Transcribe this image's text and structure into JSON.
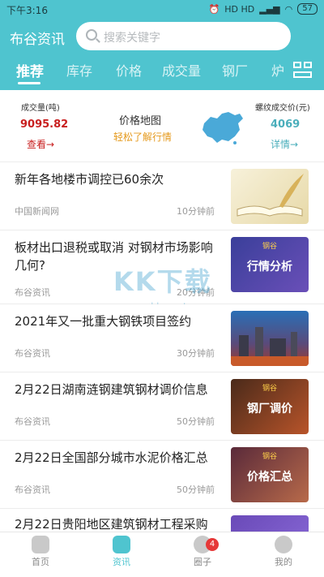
{
  "status_bar": {
    "time": "下午3:16",
    "indicators": "HD HD",
    "battery": "57"
  },
  "header": {
    "brand": "布谷资讯",
    "search_placeholder": "搜索关键字",
    "tabs": [
      {
        "label": "推荐",
        "active": true
      },
      {
        "label": "库存",
        "active": false
      },
      {
        "label": "价格",
        "active": false
      },
      {
        "label": "成交量",
        "active": false
      },
      {
        "label": "钢厂",
        "active": false
      },
      {
        "label": "炉",
        "active": false
      }
    ],
    "accent_color": "#4fc4cf"
  },
  "market_summary": {
    "volume_label": "成交量(吨)",
    "volume_value": "9095.82",
    "volume_link": "查看→",
    "map_title": "价格地图",
    "map_subtitle": "轻松了解行情",
    "price_label": "螺纹成交价(元)",
    "price_value": "4069",
    "price_link": "详情→"
  },
  "news": [
    {
      "title": "新年各地楼市调控已60余次",
      "source": "中国新闻网",
      "time": "10分钟前",
      "thumb": "book-quill",
      "thumb_text": ""
    },
    {
      "title": "板材出口退税或取消 对钢材市场影响几何?",
      "source": "布谷资讯",
      "time": "20分钟前",
      "thumb": "steel-analysis",
      "thumb_text": "行情分析",
      "thumb_small": "钢谷"
    },
    {
      "title": "2021年又一批重大钢铁项目签约",
      "source": "布谷资讯",
      "time": "30分钟前",
      "thumb": "steel-plant",
      "thumb_text": ""
    },
    {
      "title": "2月22日湖南涟钢建筑钢材调价信息",
      "source": "布谷资讯",
      "time": "50分钟前",
      "thumb": "mill-price",
      "thumb_text": "钢厂调价",
      "thumb_small": "钢谷"
    },
    {
      "title": "2月22日全国部分城市水泥价格汇总",
      "source": "布谷资讯",
      "time": "50分钟前",
      "thumb": "price-summary",
      "thumb_text": "价格汇总",
      "thumb_small": "钢谷"
    },
    {
      "title": "2月22日贵阳地区建筑钢材工程采购",
      "source": "",
      "time": "",
      "thumb": "crane",
      "thumb_text": "",
      "thumb_small": "钢谷"
    }
  ],
  "watermark": {
    "text": "KK下载",
    "url": "www.kkx.net"
  },
  "bottom_nav": [
    {
      "label": "首页",
      "icon": "home-icon",
      "active": false
    },
    {
      "label": "资讯",
      "icon": "news-icon",
      "active": true
    },
    {
      "label": "圈子",
      "icon": "circle-icon",
      "active": false,
      "badge": "4"
    },
    {
      "label": "我的",
      "icon": "profile-icon",
      "active": false
    }
  ]
}
